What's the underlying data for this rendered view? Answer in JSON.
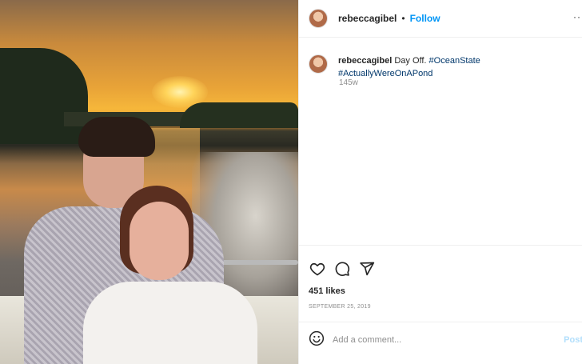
{
  "post": {
    "username": "rebeccagibel",
    "follow_label": "Follow",
    "separator": "•",
    "more_label": "···",
    "caption_text": "Day Off.",
    "hashtags": [
      "#OceanState",
      "#ActuallyWereOnAPond"
    ],
    "time_ago": "145w",
    "likes": "451 likes",
    "date": "SEPTEMBER 25, 2019"
  },
  "comment": {
    "placeholder": "Add a comment...",
    "post_label": "Post"
  },
  "icons": {
    "like": "heart-icon",
    "comment": "comment-icon",
    "share": "share-icon",
    "emoji": "emoji-icon"
  },
  "colors": {
    "follow": "#0095f6",
    "hashtag": "#00376b",
    "muted": "#8e8e8e"
  }
}
